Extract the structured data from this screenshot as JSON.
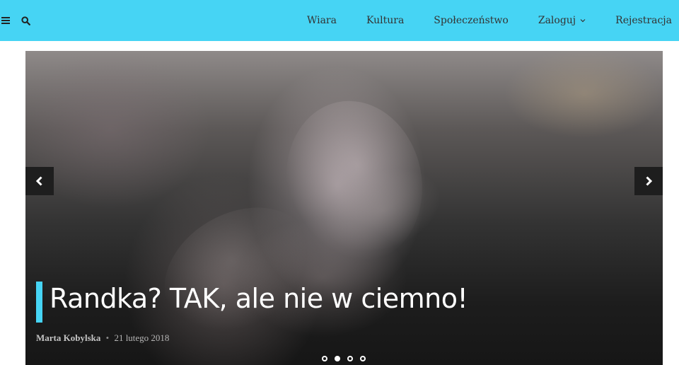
{
  "header": {
    "menu_icon": "hamburger-icon",
    "search_icon": "search-icon",
    "nav": [
      {
        "label": "Wiara"
      },
      {
        "label": "Kultura"
      },
      {
        "label": "Społeczeństwo"
      },
      {
        "label": "Zaloguj",
        "icon": "chevron-down-icon"
      },
      {
        "label": "Rejestracja"
      }
    ],
    "bar_color": "#46d4f4"
  },
  "slider": {
    "prev_icon": "chevron-left-icon",
    "next_icon": "chevron-right-icon",
    "slide": {
      "title": "Randka? TAK, ale nie w ciemno!",
      "author": "Marta Kobylska",
      "separator": "•",
      "date": "21 lutego 2018"
    },
    "dots_count": 4,
    "active_dot": 2
  }
}
